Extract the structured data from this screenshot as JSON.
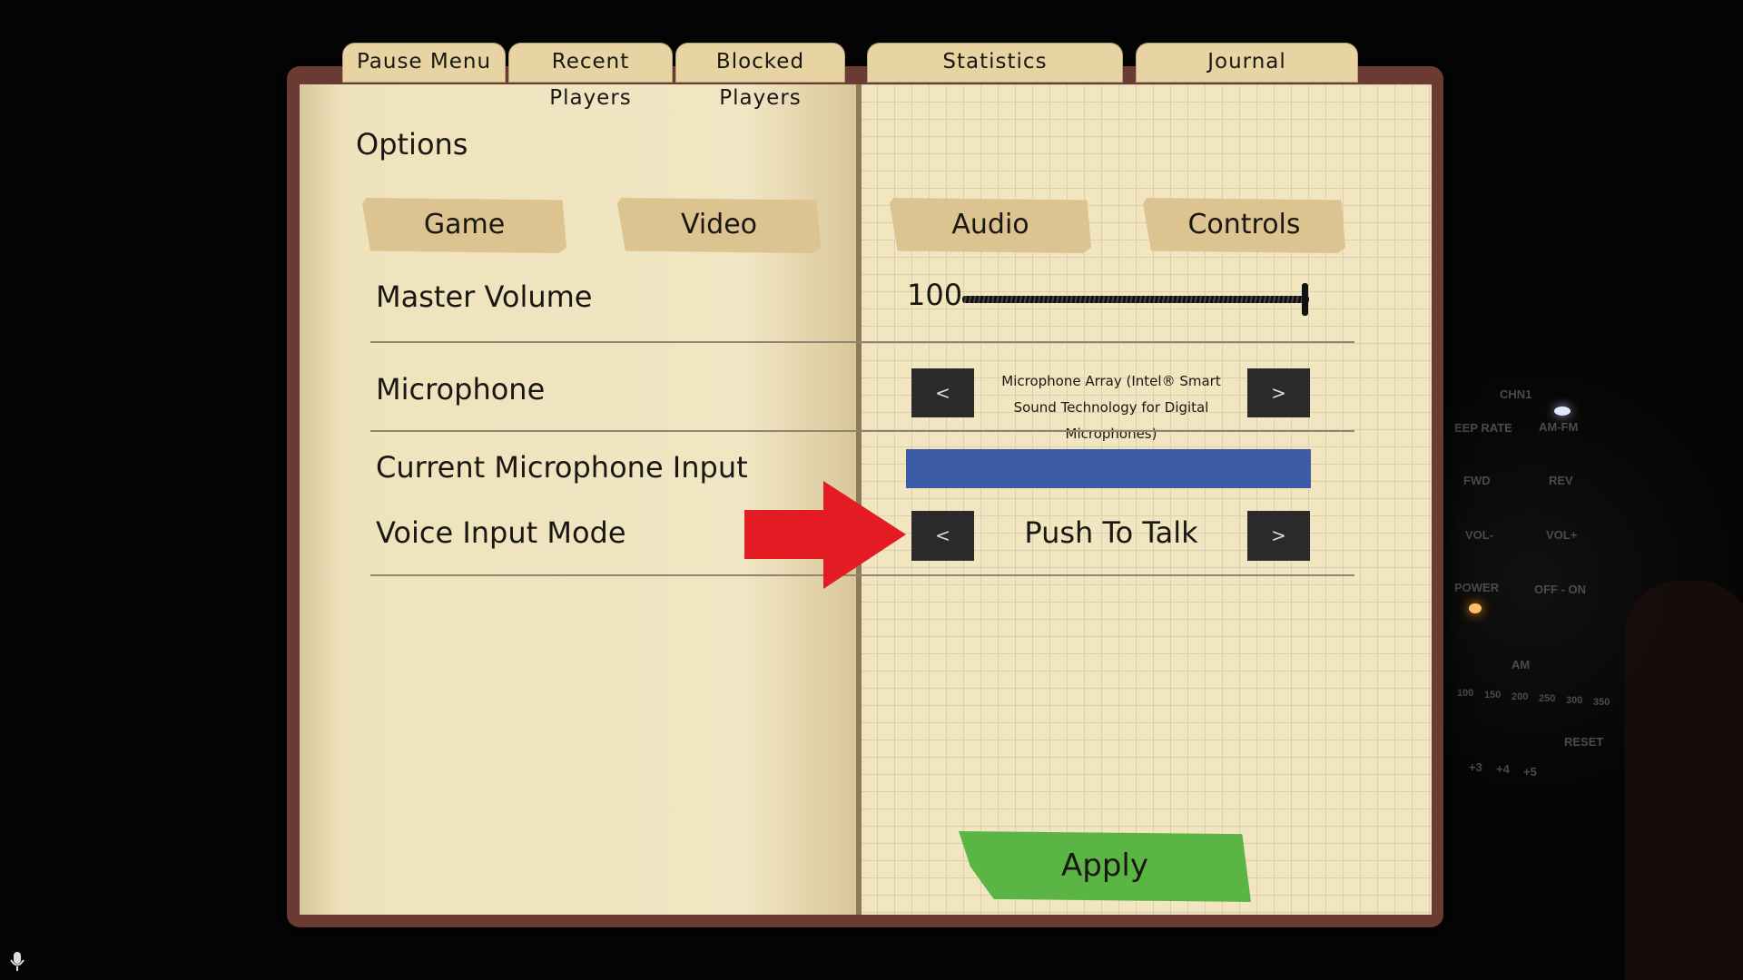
{
  "tabs": [
    "Pause Menu",
    "Recent Players",
    "Blocked Players",
    "Statistics",
    "Journal"
  ],
  "options_title": "Options",
  "subtabs": [
    "Game",
    "Video",
    "Audio",
    "Controls"
  ],
  "settings": {
    "master_volume": {
      "label": "Master Volume",
      "value": "100",
      "level_percent": 100
    },
    "microphone": {
      "label": "Microphone",
      "value": "Microphone Array (Intel® Smart Sound Technology for Digital Microphones)",
      "prev": "<",
      "next": ">"
    },
    "mic_input": {
      "label": "Current Microphone Input",
      "level_percent": 100,
      "color": "#3d5ba6"
    },
    "voice_mode": {
      "label": "Voice Input Mode",
      "value": "Push To Talk",
      "prev": "<",
      "next": ">"
    }
  },
  "apply_label": "Apply",
  "apply_color": "#5bb545",
  "highlight_arrow_color": "#e31b23",
  "radio": {
    "labels": [
      "CHN1",
      "EEP RATE",
      "AM-FM",
      "FWD",
      "REV",
      "VOL-",
      "VOL+",
      "POWER",
      "OFF - ON",
      "AM",
      "100",
      "150",
      "200",
      "250",
      "300",
      "350",
      "RESET",
      "+3",
      "+4",
      "+5"
    ]
  },
  "mic_icon": "microphone-icon"
}
